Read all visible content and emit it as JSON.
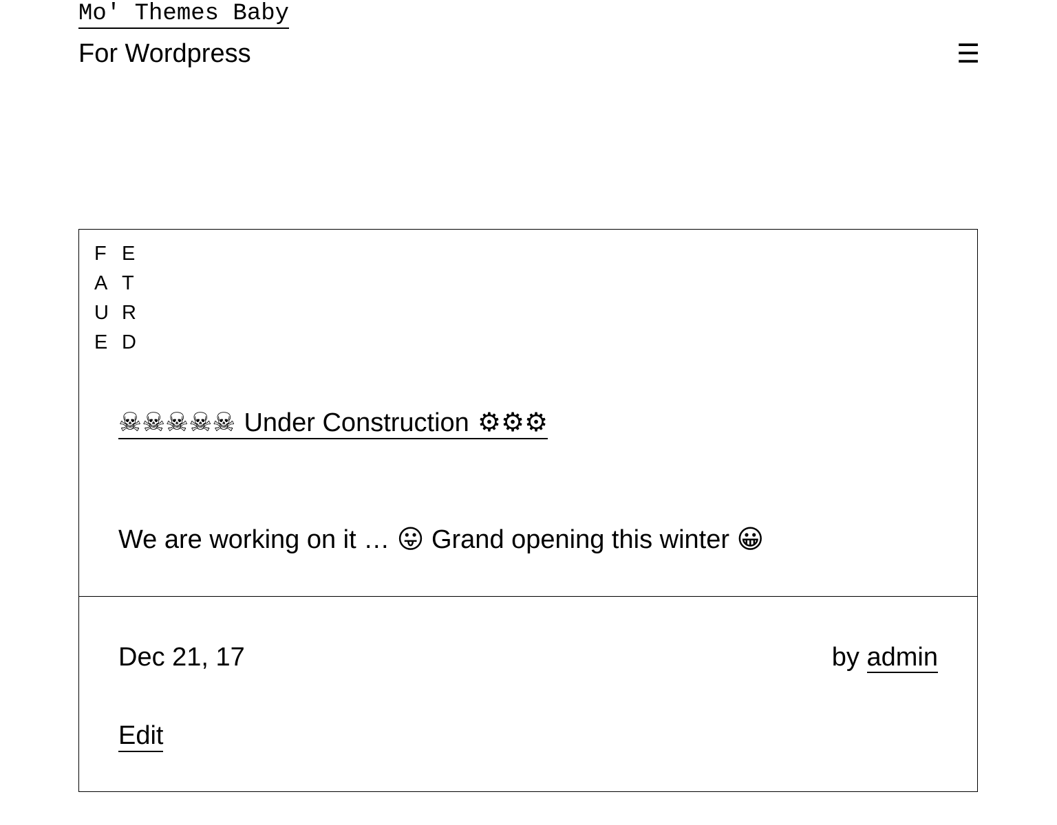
{
  "site": {
    "title": "Mo' Themes Baby",
    "tagline": "For Wordpress",
    "menu_icon": "☰"
  },
  "post": {
    "featured_letters": [
      "F",
      "E",
      "A",
      "T",
      "U",
      "R",
      "E",
      "D"
    ],
    "title_prefix_icons": "☠☠☠☠☠",
    "title_text": "Under Construction",
    "title_suffix_icons": "⚙⚙⚙",
    "excerpt": "We are working on it … 😛 Grand opening this winter 😀",
    "date": "Dec 21, 17",
    "author_prefix": "by",
    "author": "admin",
    "edit_label": "Edit"
  }
}
